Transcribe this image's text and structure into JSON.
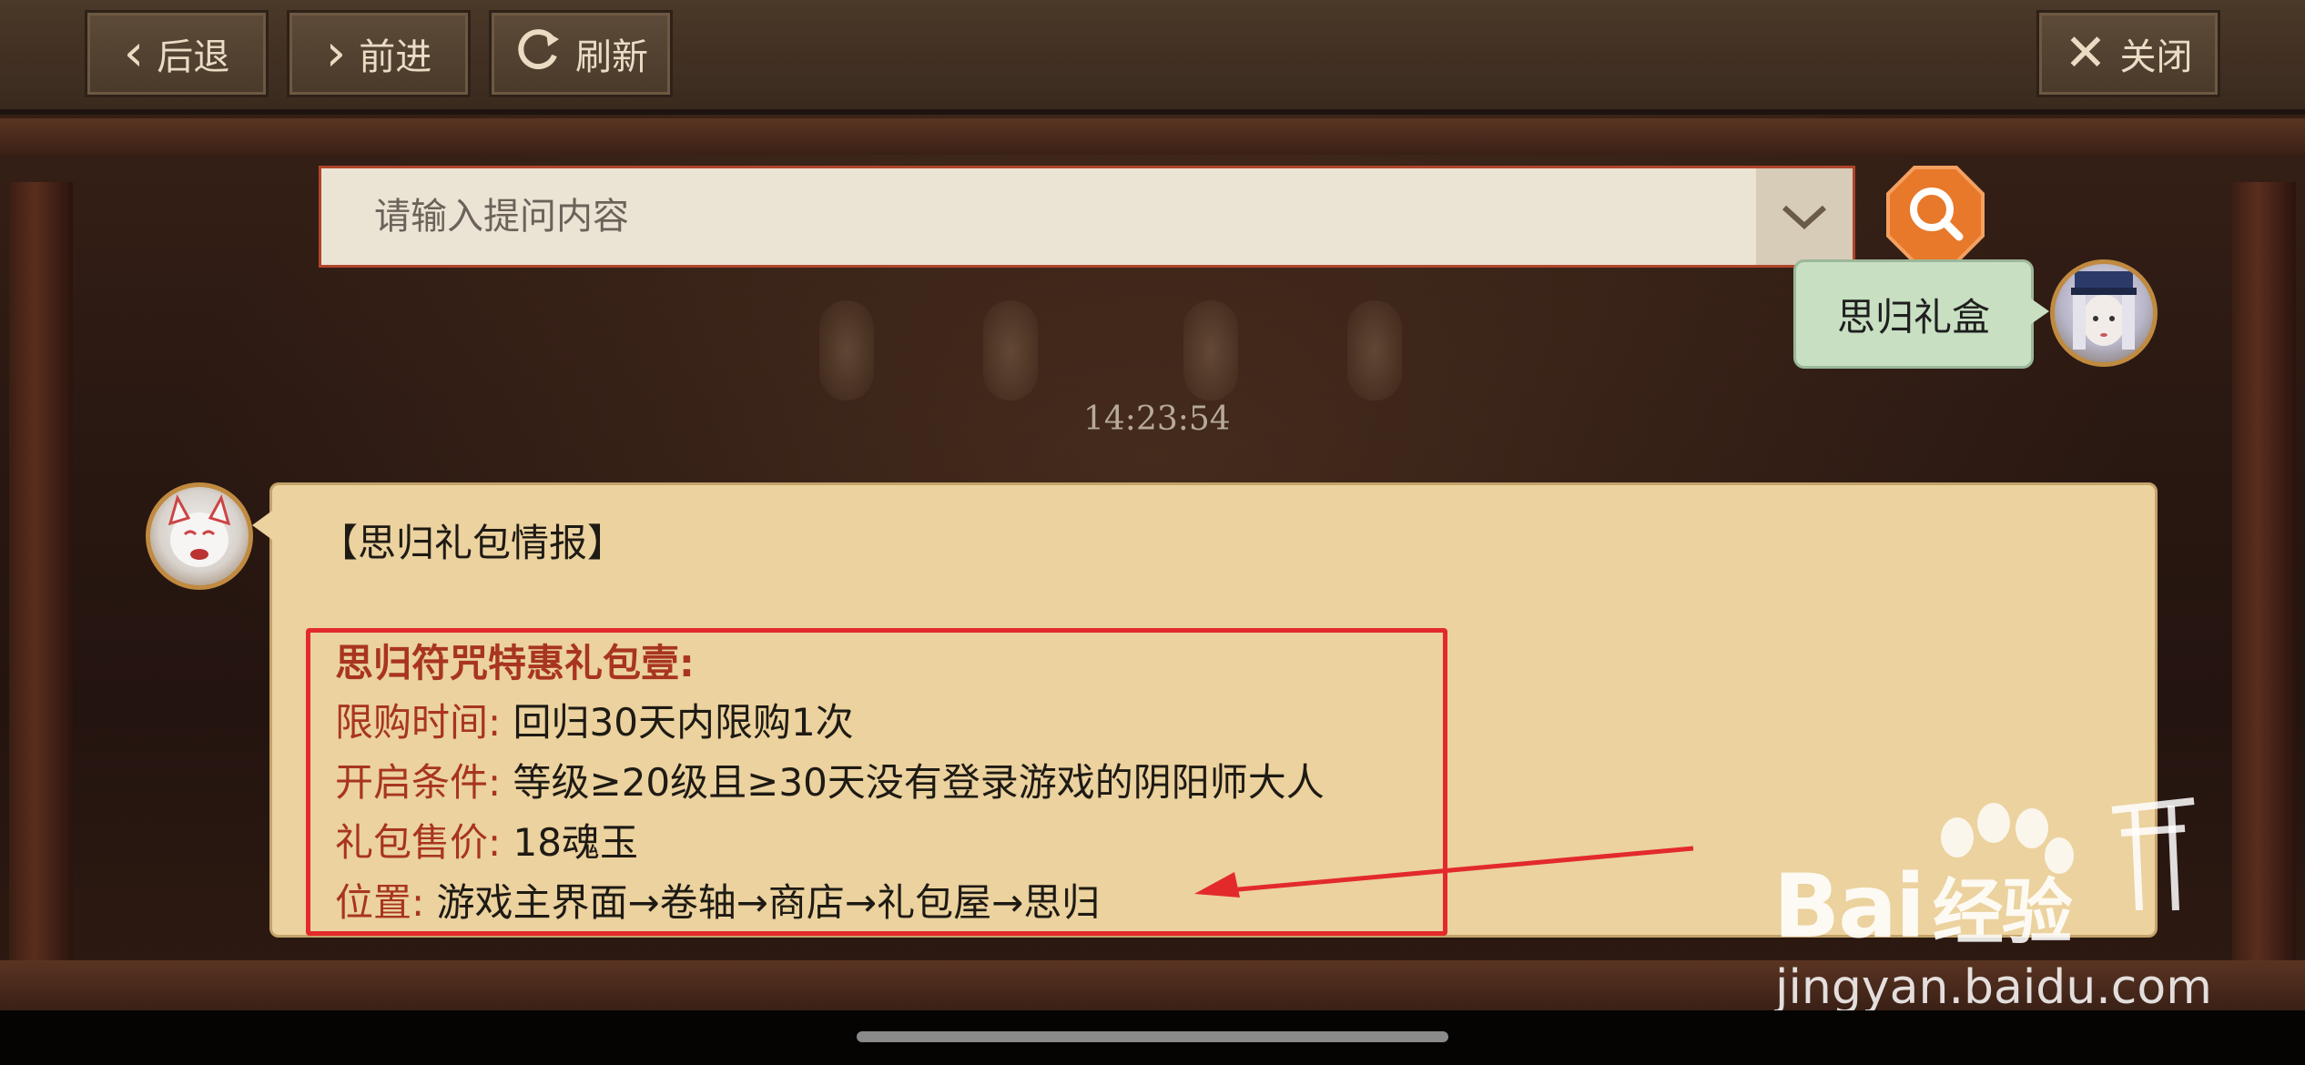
{
  "toolbar": {
    "back_label": "后退",
    "forward_label": "前进",
    "refresh_label": "刷新",
    "close_label": "关闭"
  },
  "search": {
    "placeholder": "请输入提问内容"
  },
  "chat": {
    "question": "思归礼盒",
    "timestamp": "14:23:54",
    "answer": {
      "title": "【思归礼包情报】",
      "heading": "思归符咒特惠礼包壹:",
      "rows": [
        {
          "label": "限购时间:",
          "value": "回归30天内限购1次"
        },
        {
          "label": "开启条件:",
          "value": "等级≥20级且≥30天没有登录游戏的阴阳师大人"
        },
        {
          "label": "礼包售价:",
          "value": "18魂玉"
        },
        {
          "label": "位置:",
          "value": "游戏主界面→卷轴→商店→礼包屋→思归"
        }
      ]
    }
  },
  "watermark": {
    "brand": "Bai",
    "brand_suffix": "经验",
    "url": "jingyan.baidu.com"
  },
  "colors": {
    "highlight_box": "#e32a2a",
    "label_red": "#a8351f",
    "answer_bg": "#ebd29e",
    "question_bg": "#c8dfc2",
    "search_btn": "#e8782a"
  }
}
